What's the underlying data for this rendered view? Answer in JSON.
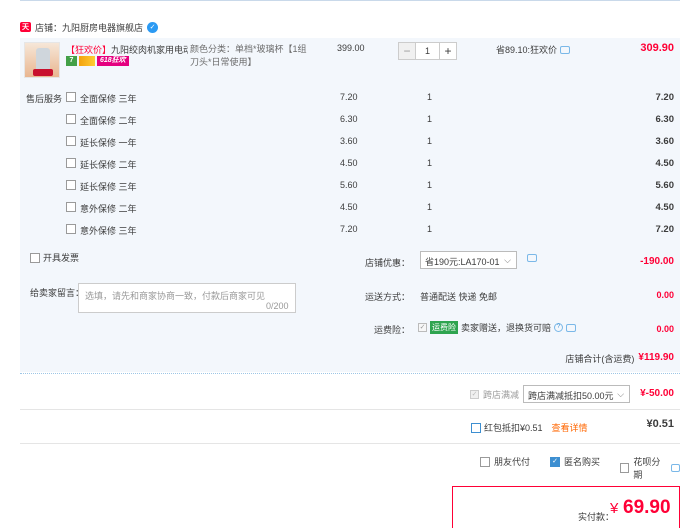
{
  "shop": {
    "icon": "tmall-icon",
    "label": "店铺：九阳厨房电器旗舰店",
    "chat_icon": "wangwang-icon"
  },
  "item": {
    "title_tag": "【狂欢价】",
    "title": "九阳绞肉机家用电动…",
    "badges": [
      "7",
      "coupon",
      "618狂欢"
    ],
    "sku": "颜色分类：单档*玻璃杯【1组刀头*日常使用】",
    "unit_price": "399.00",
    "quantity": "1",
    "minus": "−",
    "plus": "+",
    "save_text": "省89.10:狂欢价",
    "subtotal": "309.90"
  },
  "services": {
    "label": "售后服务",
    "rows": [
      {
        "name": "全面保修  三年",
        "price": "7.20",
        "qty": "1",
        "total": "7.20"
      },
      {
        "name": "全面保修  二年",
        "price": "6.30",
        "qty": "1",
        "total": "6.30"
      },
      {
        "name": "延长保修  一年",
        "price": "3.60",
        "qty": "1",
        "total": "3.60"
      },
      {
        "name": "延长保修  二年",
        "price": "4.50",
        "qty": "1",
        "total": "4.50"
      },
      {
        "name": "延长保修  三年",
        "price": "5.60",
        "qty": "1",
        "total": "5.60"
      },
      {
        "name": "意外保修  二年",
        "price": "4.50",
        "qty": "1",
        "total": "4.50"
      },
      {
        "name": "意外保修  三年",
        "price": "7.20",
        "qty": "1",
        "total": "7.20"
      }
    ]
  },
  "order": {
    "anonymous_label": "开具发票",
    "message_label": "给卖家留言：",
    "message_placeholder": "选填，请先和商家协商一致，付款后商家可见",
    "message_count": "0/200",
    "shop_promo_label": "店铺优惠：",
    "shop_promo_value": "省190元:LA170-01",
    "shop_promo_amount": "-190.00",
    "shipping_label": "运送方式：",
    "shipping_value": "普通配送 快递 免邮",
    "shipping_amount": "0.00",
    "insurance_label": "运费险：",
    "insurance_badge": "运费险",
    "insurance_text": "卖家赠送，退换货可赔",
    "insurance_help": "?",
    "insurance_amount": "0.00",
    "shop_total_label": "店铺合计(含运费)",
    "shop_total_amount": "¥119.90"
  },
  "cross_store": {
    "label": "跨店满减",
    "select_value": "跨店满减抵扣50.00元",
    "amount": "¥-50.00"
  },
  "red_packet": {
    "label": "红包抵扣¥0.51",
    "link": "查看详情",
    "amount": "¥0.51"
  },
  "options": {
    "friend_pay": "朋友代付",
    "anonymous": "匿名购买",
    "huabei": "花呗分期"
  },
  "payment": {
    "label": "实付款：",
    "currency": "¥",
    "amount": "69.90"
  },
  "colors": {
    "accent_red": "#ff0036",
    "link_blue": "#3d8fd1",
    "panel_bg": "#f3f7fc"
  }
}
